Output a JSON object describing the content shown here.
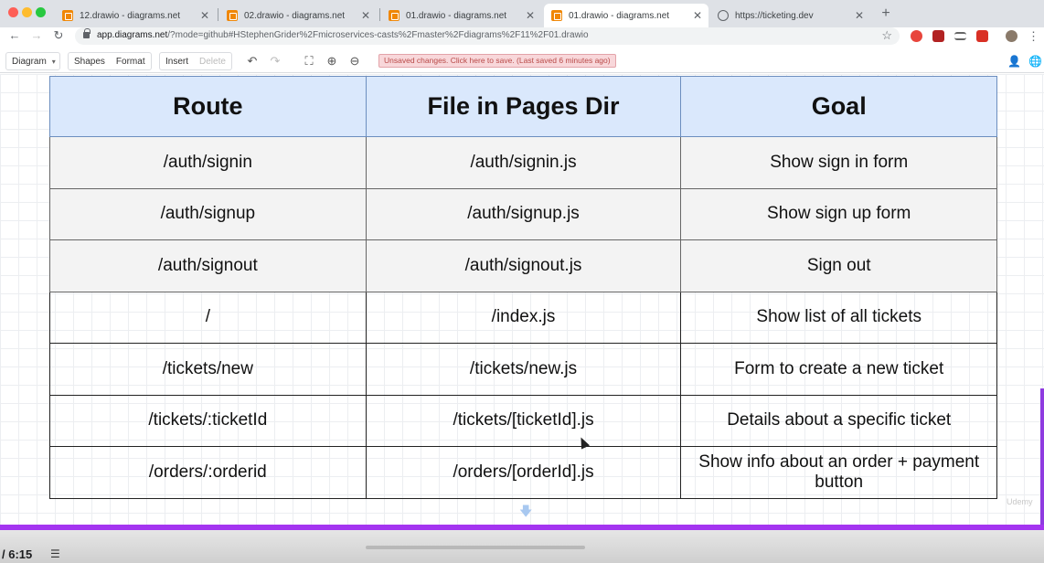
{
  "browser": {
    "tabs": [
      {
        "title": "12.drawio - diagrams.net",
        "icon": "drawio-icon",
        "active": false
      },
      {
        "title": "02.drawio - diagrams.net",
        "icon": "drawio-icon",
        "active": false
      },
      {
        "title": "01.drawio - diagrams.net",
        "icon": "drawio-icon",
        "active": false
      },
      {
        "title": "01.drawio - diagrams.net",
        "icon": "drawio-icon",
        "active": true
      },
      {
        "title": "https://ticketing.dev",
        "icon": "globe-icon",
        "active": false
      }
    ],
    "tab_close": "✕",
    "new_tab": "+",
    "url_host": "app.diagrams.net",
    "url_rest": "/?mode=github#HStephenGrider%2Fmicroservices-casts%2Fmaster%2Fdiagrams%2F11%2F01.drawio",
    "back": "←",
    "forward": "→",
    "reload": "↻",
    "bookmark_star": "☆"
  },
  "toolbar": {
    "diagram_label": "Diagram",
    "shapes_label": "Shapes",
    "format_label": "Format",
    "insert_label": "Insert",
    "delete_label": "Delete",
    "unsaved_message": "Unsaved changes. Click here to save. (Last saved 6 minutes ago)"
  },
  "table": {
    "headers": [
      "Route",
      "File in Pages Dir",
      "Goal"
    ],
    "rows": [
      {
        "route": "/auth/signin",
        "file": "/auth/signin.js",
        "goal": "Show sign in form",
        "shade": "gray"
      },
      {
        "route": "/auth/signup",
        "file": "/auth/signup.js",
        "goal": "Show sign up form",
        "shade": "gray"
      },
      {
        "route": "/auth/signout",
        "file": "/auth/signout.js",
        "goal": "Sign out",
        "shade": "gray"
      },
      {
        "route": "/",
        "file": "/index.js",
        "goal": "Show list of all tickets",
        "shade": "white"
      },
      {
        "route": "/tickets/new",
        "file": "/tickets/new.js",
        "goal": "Form to create a new ticket",
        "shade": "white"
      },
      {
        "route": "/tickets/:ticketId",
        "file": "/tickets/[ticketId].js",
        "goal": "Details about a specific ticket",
        "shade": "white"
      },
      {
        "route": "/orders/:orderid",
        "file": "/orders/[orderId].js",
        "goal": "Show info about an order + payment button",
        "shade": "white"
      }
    ]
  },
  "watermark": "Udemy",
  "player": {
    "time": "/ 6:15",
    "progress_color": "#a435f0"
  },
  "colors": {
    "header_fill": "#dae8fc",
    "header_stroke": "#6c8ebf",
    "gray_row_fill": "#f3f3f3",
    "unsaved_bg": "#f8d7da"
  }
}
